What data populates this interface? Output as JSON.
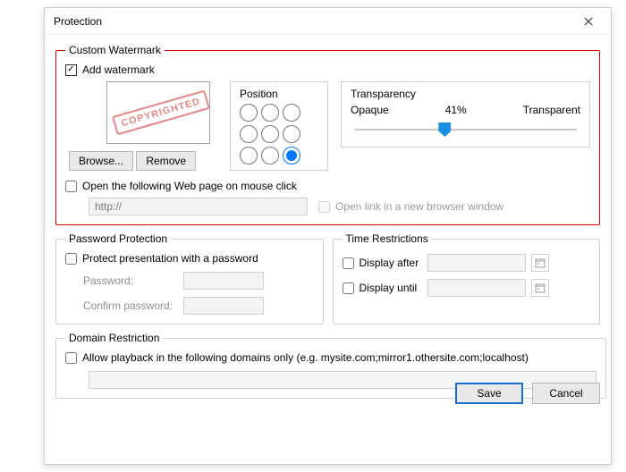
{
  "window": {
    "title": "Protection"
  },
  "custom_watermark": {
    "legend": "Custom Watermark",
    "add_label": "Add watermark",
    "stamp_text": "COPYRIGHTED",
    "browse_label": "Browse...",
    "remove_label": "Remove",
    "position_label": "Position",
    "transparency": {
      "label": "Transparency",
      "opaque": "Opaque",
      "percent": "41%",
      "transparent": "Transparent",
      "value_pct": 41
    },
    "open_web_label": "Open the following Web page on mouse click",
    "url_value": "http://",
    "open_new_window_label": "Open link in a new browser window"
  },
  "password": {
    "legend": "Password Protection",
    "protect_label": "Protect presentation with a password",
    "password_label": "Password:",
    "confirm_label": "Confirm password:"
  },
  "time": {
    "legend": "Time Restrictions",
    "after_label": "Display after",
    "until_label": "Display until"
  },
  "domain": {
    "legend": "Domain Restriction",
    "allow_label": "Allow playback in the following domains only (e.g. mysite.com;mirror1.othersite.com;localhost)"
  },
  "footer": {
    "save": "Save",
    "cancel": "Cancel"
  }
}
